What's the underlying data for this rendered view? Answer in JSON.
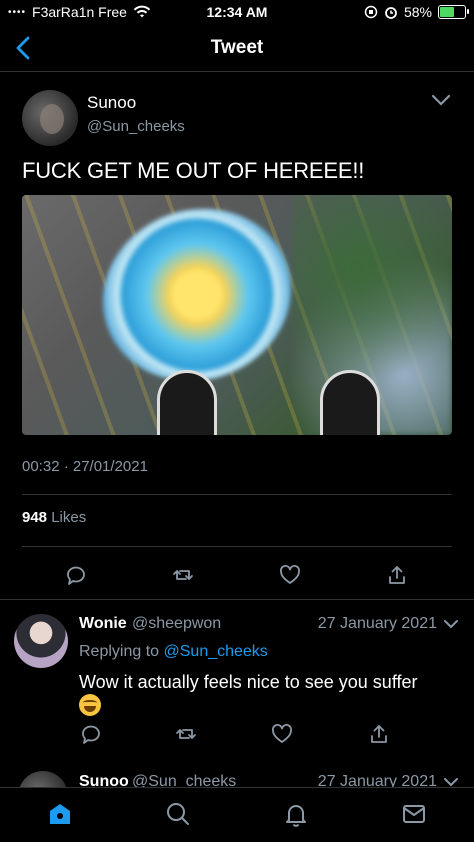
{
  "status_bar": {
    "carrier": "F3arRa1n Free",
    "time": "12:34 AM",
    "battery_percent": "58%",
    "battery_level": 0.58,
    "battery_color": "#4cd964"
  },
  "nav": {
    "title": "Tweet",
    "back_icon": "chevron-left-icon"
  },
  "tweet": {
    "author_name": "Sunoo",
    "author_handle": "@Sun_cheeks",
    "text": "FUCK GET ME OUT OF HEREEE!!",
    "timestamp": "00:32 · 27/01/2021",
    "likes_count": "948",
    "likes_label": "Likes",
    "actions": [
      "reply-icon",
      "retweet-icon",
      "like-icon",
      "share-icon"
    ]
  },
  "reply": {
    "author_name": "Wonie",
    "author_handle": "@sheepwon",
    "date": "27 January 2021",
    "replying_to_label": "Replying to",
    "replying_to_handle": "@Sun_cheeks",
    "text": "Wow it actually feels nice to see you suffer",
    "emoji": "joy-emoji"
  },
  "next_tweet": {
    "author_name": "Sunoo",
    "author_handle": "@Sun_cheeks",
    "date": "27 January 2021"
  },
  "tab_bar": {
    "items": [
      "home-icon",
      "search-icon",
      "notifications-icon",
      "messages-icon"
    ],
    "accent": "#1d9bf0",
    "muted": "#8b98a5"
  }
}
